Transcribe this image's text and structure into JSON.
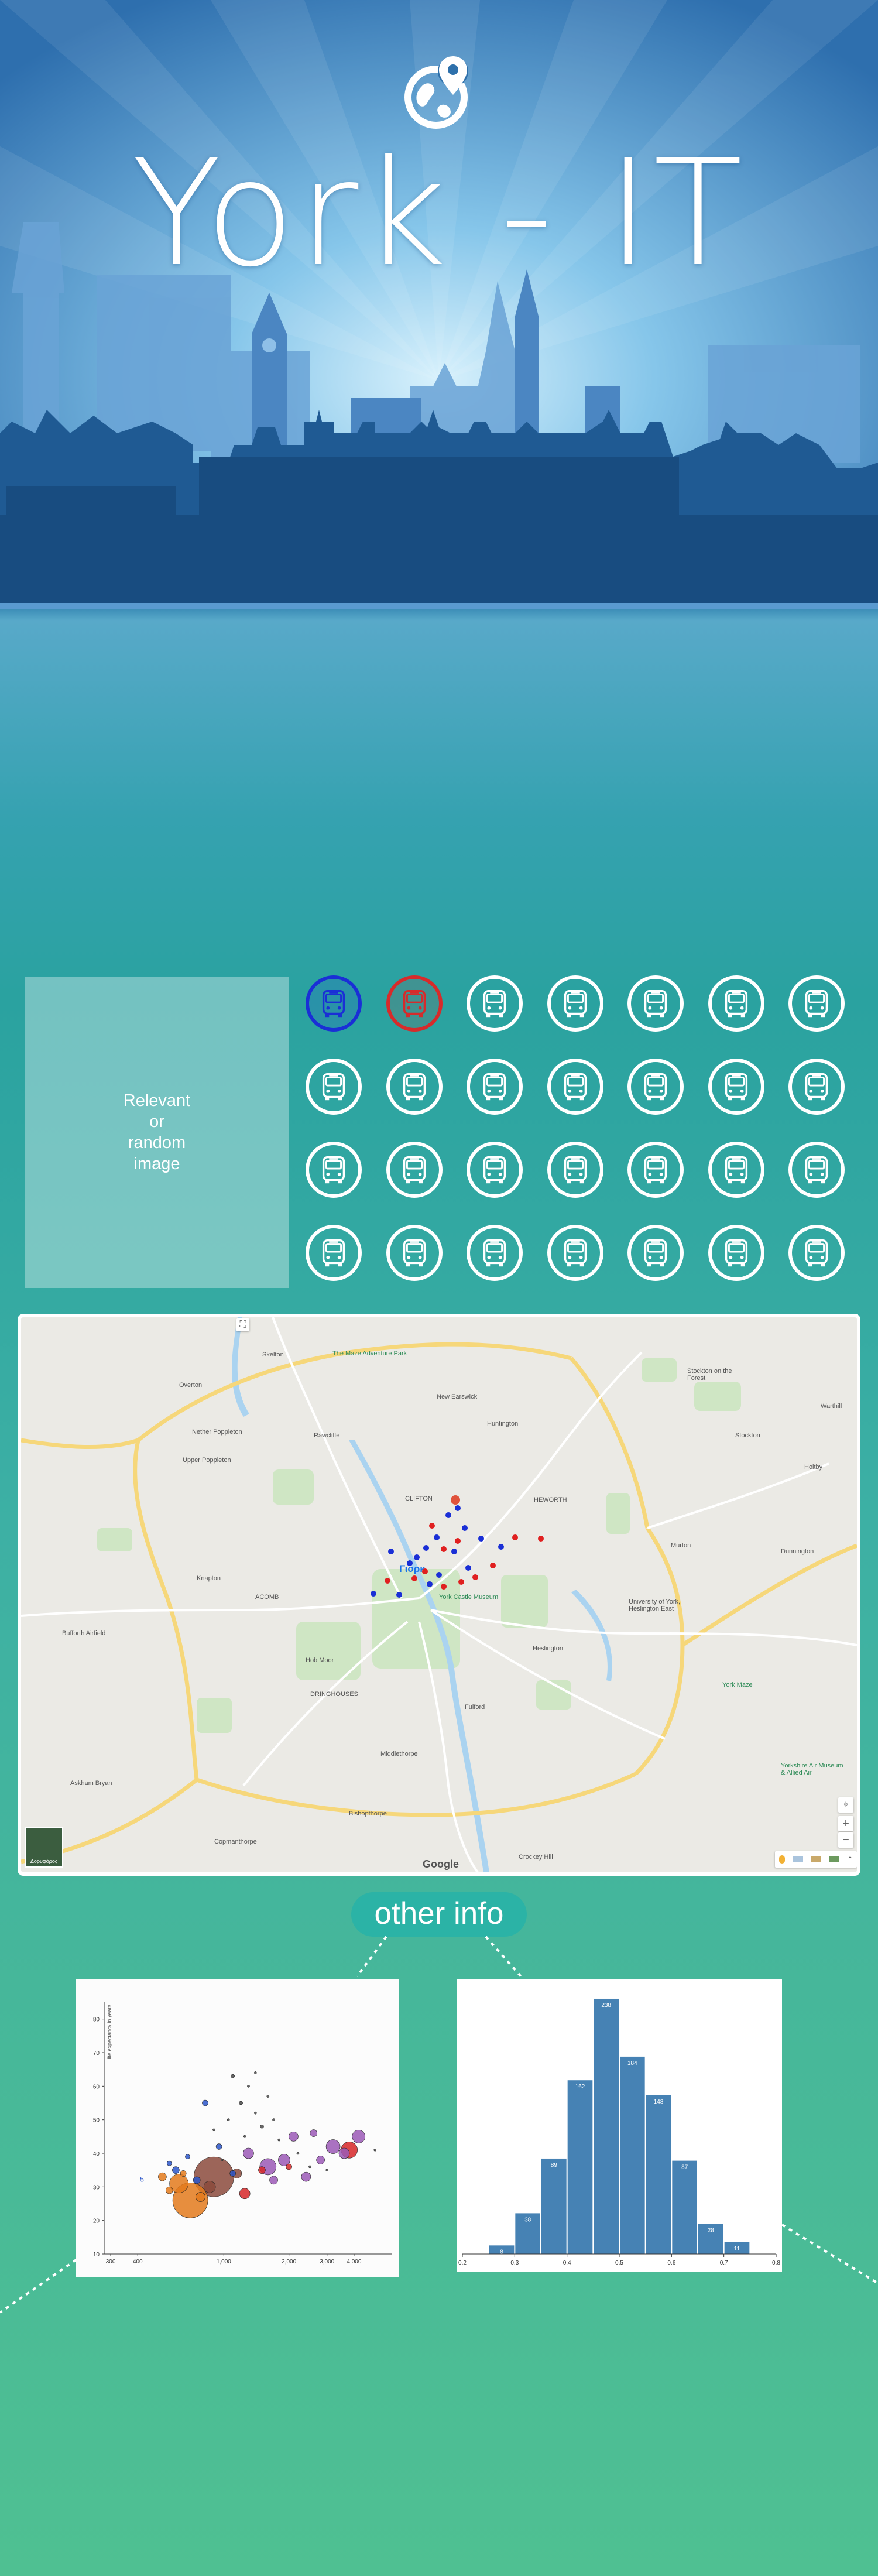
{
  "site": {
    "title": "York - IT",
    "logo_icon": "globe-location-pin-icon"
  },
  "panel": {
    "image_placeholder": "Relevant\nor\nrandom\nimage",
    "route_buttons": [
      {
        "icon": "bus-icon",
        "color": "#1a2fd6",
        "state": "selected-blue"
      },
      {
        "icon": "bus-icon",
        "color": "#d62b2b",
        "state": "selected-red"
      },
      {
        "icon": "bus-icon",
        "color": "#ffffff",
        "state": "default"
      },
      {
        "icon": "bus-icon",
        "color": "#ffffff",
        "state": "default"
      },
      {
        "icon": "bus-icon",
        "color": "#ffffff",
        "state": "default"
      },
      {
        "icon": "bus-icon",
        "color": "#ffffff",
        "state": "default"
      },
      {
        "icon": "bus-icon",
        "color": "#ffffff",
        "state": "default"
      },
      {
        "icon": "bus-icon",
        "color": "#ffffff",
        "state": "default"
      },
      {
        "icon": "bus-icon",
        "color": "#ffffff",
        "state": "default"
      },
      {
        "icon": "bus-icon",
        "color": "#ffffff",
        "state": "default"
      },
      {
        "icon": "bus-icon",
        "color": "#ffffff",
        "state": "default"
      },
      {
        "icon": "bus-icon",
        "color": "#ffffff",
        "state": "default"
      },
      {
        "icon": "bus-icon",
        "color": "#ffffff",
        "state": "default"
      },
      {
        "icon": "bus-icon",
        "color": "#ffffff",
        "state": "default"
      },
      {
        "icon": "bus-icon",
        "color": "#ffffff",
        "state": "default"
      },
      {
        "icon": "bus-icon",
        "color": "#ffffff",
        "state": "default"
      },
      {
        "icon": "bus-icon",
        "color": "#ffffff",
        "state": "default"
      },
      {
        "icon": "bus-icon",
        "color": "#ffffff",
        "state": "default"
      },
      {
        "icon": "bus-icon",
        "color": "#ffffff",
        "state": "default"
      },
      {
        "icon": "bus-icon",
        "color": "#ffffff",
        "state": "default"
      },
      {
        "icon": "bus-icon",
        "color": "#ffffff",
        "state": "default"
      },
      {
        "icon": "bus-icon",
        "color": "#ffffff",
        "state": "default"
      },
      {
        "icon": "bus-icon",
        "color": "#ffffff",
        "state": "default"
      },
      {
        "icon": "bus-icon",
        "color": "#ffffff",
        "state": "default"
      },
      {
        "icon": "bus-icon",
        "color": "#ffffff",
        "state": "default"
      },
      {
        "icon": "bus-icon",
        "color": "#ffffff",
        "state": "default"
      },
      {
        "icon": "bus-icon",
        "color": "#ffffff",
        "state": "default"
      },
      {
        "icon": "bus-icon",
        "color": "#ffffff",
        "state": "default"
      }
    ]
  },
  "map": {
    "provider": "Google",
    "satellite_toggle_label": "Δορυφόρος",
    "zoom_in": "+",
    "zoom_out": "−",
    "center_label": "Γιορκ",
    "place_labels": [
      "Skelton",
      "The Maze Adventure Park",
      "Stockton on the Forest",
      "Overton",
      "New Earswick",
      "Nether Poppleton",
      "Upper Poppleton",
      "Rawcliffe",
      "Huntington",
      "Warthill",
      "Stockton",
      "CLIFTON",
      "Holtby",
      "Knapton",
      "HEWORTH",
      "Dunnington",
      "ACOMB",
      "Murton",
      "York Castle Museum",
      "University of York, Heslington East",
      "Bufforth Airfield",
      "Hob Moor",
      "Heslington",
      "DRINGHOUSES",
      "Fulford",
      "York Maze",
      "Middlethorpe",
      "Askham Bryan",
      "Bishopthorpe",
      "Yorkshire Air Museum & Allied Air",
      "Copmanthorpe",
      "Crockey Hill"
    ],
    "stops_blue_count": 16,
    "stops_red_count": 12,
    "colors": {
      "blue_stop": "#1a2fd6",
      "red_stop": "#e02020"
    }
  },
  "other_info": {
    "label": "other info"
  },
  "chart_data": [
    {
      "type": "scatter",
      "subtype": "bubble",
      "ylabel": "life expectancy in years",
      "xscale": "log",
      "x_tick_labels": [
        "300",
        "400",
        "1,000",
        "2,000",
        "3,000",
        "4,000"
      ],
      "y_tick_labels": [
        "10",
        "20",
        "30",
        "40",
        "50",
        "60",
        "70",
        "80"
      ],
      "ylim": [
        10,
        85
      ],
      "annotation": "5",
      "series": [
        {
          "color": "#e37a1c",
          "points": [
            {
              "x": 700,
              "y": 26,
              "r": 30
            },
            {
              "x": 620,
              "y": 31,
              "r": 16
            },
            {
              "x": 520,
              "y": 33,
              "r": 7
            },
            {
              "x": 560,
              "y": 29,
              "r": 6
            },
            {
              "x": 780,
              "y": 27,
              "r": 8
            },
            {
              "x": 650,
              "y": 34,
              "r": 5
            }
          ]
        },
        {
          "color": "#8b4a3c",
          "points": [
            {
              "x": 900,
              "y": 33,
              "r": 34
            },
            {
              "x": 860,
              "y": 30,
              "r": 10
            },
            {
              "x": 1150,
              "y": 34,
              "r": 8
            }
          ]
        },
        {
          "color": "#9b59b6",
          "points": [
            {
              "x": 1600,
              "y": 36,
              "r": 14
            },
            {
              "x": 1900,
              "y": 38,
              "r": 10
            },
            {
              "x": 2400,
              "y": 33,
              "r": 8
            },
            {
              "x": 3200,
              "y": 42,
              "r": 12
            },
            {
              "x": 4200,
              "y": 45,
              "r": 11
            },
            {
              "x": 1300,
              "y": 40,
              "r": 9
            },
            {
              "x": 2800,
              "y": 38,
              "r": 7
            },
            {
              "x": 3600,
              "y": 40,
              "r": 9
            },
            {
              "x": 2100,
              "y": 45,
              "r": 8
            },
            {
              "x": 2600,
              "y": 46,
              "r": 6
            },
            {
              "x": 1700,
              "y": 32,
              "r": 7
            }
          ]
        },
        {
          "color": "#d62728",
          "points": [
            {
              "x": 3800,
              "y": 41,
              "r": 14
            },
            {
              "x": 1250,
              "y": 28,
              "r": 9
            },
            {
              "x": 1500,
              "y": 35,
              "r": 6
            },
            {
              "x": 2000,
              "y": 36,
              "r": 5
            }
          ]
        },
        {
          "color": "#2c56c9",
          "points": [
            {
              "x": 600,
              "y": 35,
              "r": 6
            },
            {
              "x": 750,
              "y": 32,
              "r": 6
            },
            {
              "x": 950,
              "y": 42,
              "r": 5
            },
            {
              "x": 820,
              "y": 55,
              "r": 5
            },
            {
              "x": 1100,
              "y": 34,
              "r": 5
            },
            {
              "x": 560,
              "y": 37,
              "r": 4
            },
            {
              "x": 680,
              "y": 39,
              "r": 4
            }
          ]
        },
        {
          "color": "#4a4a4a",
          "points": [
            {
              "x": 1100,
              "y": 63,
              "r": 3
            },
            {
              "x": 1200,
              "y": 55,
              "r": 3
            },
            {
              "x": 1300,
              "y": 60,
              "r": 2
            },
            {
              "x": 1050,
              "y": 50,
              "r": 2
            },
            {
              "x": 1400,
              "y": 52,
              "r": 2
            },
            {
              "x": 1500,
              "y": 48,
              "r": 3
            },
            {
              "x": 1250,
              "y": 45,
              "r": 2
            },
            {
              "x": 1600,
              "y": 57,
              "r": 2
            },
            {
              "x": 1700,
              "y": 50,
              "r": 2
            },
            {
              "x": 900,
              "y": 47,
              "r": 2
            },
            {
              "x": 1800,
              "y": 44,
              "r": 2
            },
            {
              "x": 2200,
              "y": 40,
              "r": 2
            },
            {
              "x": 2500,
              "y": 36,
              "r": 2
            },
            {
              "x": 3000,
              "y": 35,
              "r": 2
            },
            {
              "x": 1400,
              "y": 64,
              "r": 2
            },
            {
              "x": 980,
              "y": 38,
              "r": 2
            },
            {
              "x": 5000,
              "y": 41,
              "r": 2
            }
          ]
        }
      ]
    },
    {
      "type": "bar",
      "subtype": "histogram",
      "x_tick_labels": [
        "0.2",
        "0.3",
        "0.4",
        "0.5",
        "0.6",
        "0.7",
        "0.8"
      ],
      "bins": [
        {
          "x0": 0.25,
          "x1": 0.3,
          "value": 8
        },
        {
          "x0": 0.3,
          "x1": 0.35,
          "value": 38
        },
        {
          "x0": 0.35,
          "x1": 0.4,
          "value": 89
        },
        {
          "x0": 0.4,
          "x1": 0.45,
          "value": 162
        },
        {
          "x0": 0.45,
          "x1": 0.5,
          "value": 238
        },
        {
          "x0": 0.5,
          "x1": 0.55,
          "value": 184
        },
        {
          "x0": 0.55,
          "x1": 0.6,
          "value": 148
        },
        {
          "x0": 0.6,
          "x1": 0.65,
          "value": 87
        },
        {
          "x0": 0.65,
          "x1": 0.7,
          "value": 28
        },
        {
          "x0": 0.7,
          "x1": 0.75,
          "value": 11
        }
      ],
      "ylim": [
        0,
        250
      ],
      "xlim": [
        0.2,
        0.8
      ],
      "bar_color": "#4682b4"
    }
  ]
}
